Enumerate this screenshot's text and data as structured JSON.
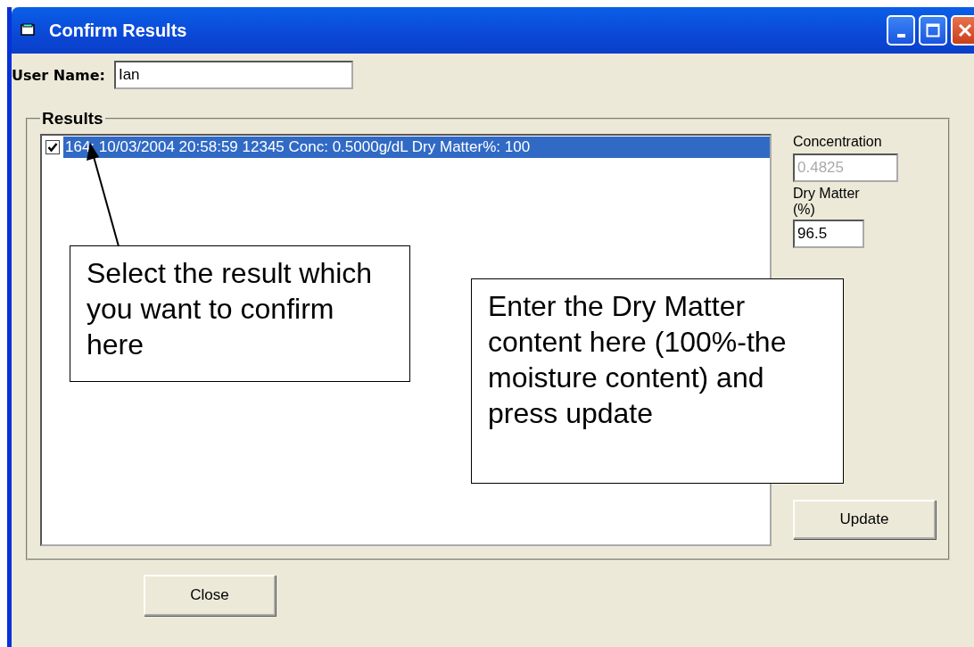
{
  "window": {
    "title": "Confirm Results"
  },
  "user_name": {
    "label": "User Name:",
    "value": "Ian"
  },
  "results": {
    "legend": "Results",
    "items": [
      {
        "text": "164: 10/03/2004 20:58:59 12345 Conc: 0.5000g/dL Dry Matter%: 100",
        "checked": true,
        "selected": true
      }
    ]
  },
  "concentration": {
    "label": "Concentration",
    "value": "0.4825",
    "disabled": true
  },
  "dry_matter": {
    "label": "Dry Matter (%)",
    "value": "96.5"
  },
  "update_button": "Update",
  "close_button": "Close",
  "callouts": [
    {
      "text": "Select the result which you want to confirm here"
    },
    {
      "text": "Enter the Dry Matter content here (100%-the moisture content) and press update"
    }
  ]
}
